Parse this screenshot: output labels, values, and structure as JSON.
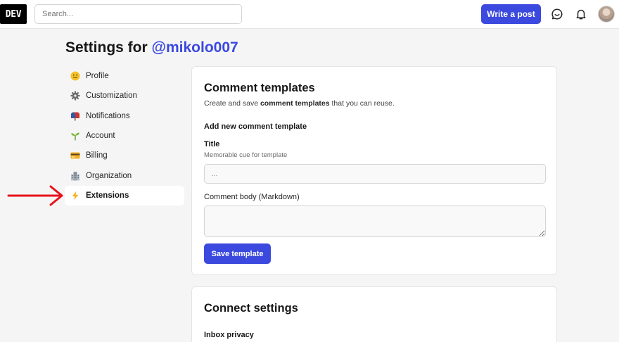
{
  "header": {
    "logo": "DEV",
    "search_placeholder": "Search...",
    "write_post_label": "Write a post",
    "icons": [
      "chat-icon",
      "bell-icon",
      "avatar"
    ]
  },
  "page": {
    "title_prefix": "Settings for ",
    "username": "@mikolo007"
  },
  "sidebar": {
    "items": [
      {
        "label": "Profile",
        "icon": "smiley-face-icon"
      },
      {
        "label": "Customization",
        "icon": "gear-icon"
      },
      {
        "label": "Notifications",
        "icon": "mailbox-icon"
      },
      {
        "label": "Account",
        "icon": "seedling-icon"
      },
      {
        "label": "Billing",
        "icon": "credit-card-icon"
      },
      {
        "label": "Organization",
        "icon": "office-building-icon"
      },
      {
        "label": "Extensions",
        "icon": "lightning-icon",
        "active": true
      }
    ]
  },
  "comment_templates": {
    "title": "Comment templates",
    "desc_before": "Create and save ",
    "desc_bold": "comment templates",
    "desc_after": " that you can reuse.",
    "add_heading": "Add new comment template",
    "title_label": "Title",
    "title_hint": "Memorable cue for template",
    "title_placeholder": "...",
    "body_label": "Comment body (Markdown)",
    "body_value": "",
    "save_label": "Save template"
  },
  "connect_settings": {
    "title": "Connect settings",
    "inbox_privacy": "Inbox privacy"
  },
  "colors": {
    "brand": "#3b49df",
    "annotation_arrow": "#e8121b"
  }
}
